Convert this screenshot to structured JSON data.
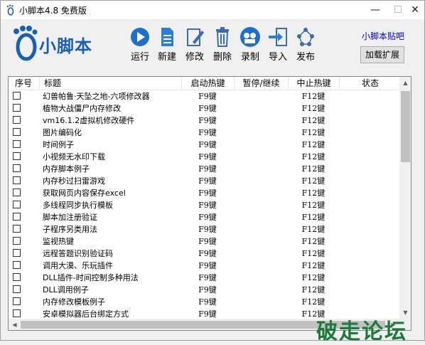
{
  "window": {
    "title": "小脚本4.8 免费版",
    "min_glyph": "—",
    "max_glyph": "☐",
    "close_glyph": "✕"
  },
  "logo": {
    "text": "小脚本"
  },
  "toolbar": {
    "run": "运行",
    "new": "新建",
    "edit": "修改",
    "delete": "删除",
    "record": "录制",
    "import": "导入",
    "publish": "发布"
  },
  "post_link": "小脚本贴吧",
  "ext_button": "加载扩展",
  "columns": [
    "序号",
    "标题",
    "启动热键",
    "暂停/继续",
    "中止热键",
    "状态"
  ],
  "rows": [
    {
      "title": "幻兽帕鲁·天坠之地-六项修改器",
      "start": "F9键",
      "stop": "F12键"
    },
    {
      "title": "植物大战僵尸内存修改",
      "start": "F9键",
      "stop": "F12键"
    },
    {
      "title": "vm16.1.2虚拟机修改硬件",
      "start": "F9键",
      "stop": "F12键"
    },
    {
      "title": "图片编码化",
      "start": "F9键",
      "stop": "F12键"
    },
    {
      "title": "时间例子",
      "start": "F9键",
      "stop": "F12键"
    },
    {
      "title": "小视频无水印下载",
      "start": "F9键",
      "stop": "F12键"
    },
    {
      "title": "内存脚本例子",
      "start": "F9键",
      "stop": "F12键"
    },
    {
      "title": "内存秒过扫雷游戏",
      "start": "F9键",
      "stop": "F12键"
    },
    {
      "title": "获取网页内容保存excel",
      "start": "F9键",
      "stop": "F12键"
    },
    {
      "title": "多线程同步执行模板",
      "start": "F9键",
      "stop": "F12键"
    },
    {
      "title": "脚本加注册验证",
      "start": "F9键",
      "stop": "F12键"
    },
    {
      "title": "子程序另类用法",
      "start": "F9键",
      "stop": "F12键"
    },
    {
      "title": "监视热键",
      "start": "F9键",
      "stop": "F12键"
    },
    {
      "title": "远程答题识别验证码",
      "start": "F9键",
      "stop": "F12键"
    },
    {
      "title": "调用大漠、乐玩插件",
      "start": "F9键",
      "stop": "F12键"
    },
    {
      "title": "DLL插件-时间控制多种用法",
      "start": "F9键",
      "stop": "F12键"
    },
    {
      "title": "DLL调用例子",
      "start": "F9键",
      "stop": "F12键"
    },
    {
      "title": "内存修改模板例子",
      "start": "F9键",
      "stop": "F12键"
    },
    {
      "title": "安卓模拟器后台绑定方式",
      "start": "F9键",
      "stop": "F12键"
    }
  ],
  "watermark": "破走论坛",
  "colors": {
    "accent": "#1a5fb4",
    "link": "#0000cc",
    "watermark": "#1c7a3a"
  }
}
